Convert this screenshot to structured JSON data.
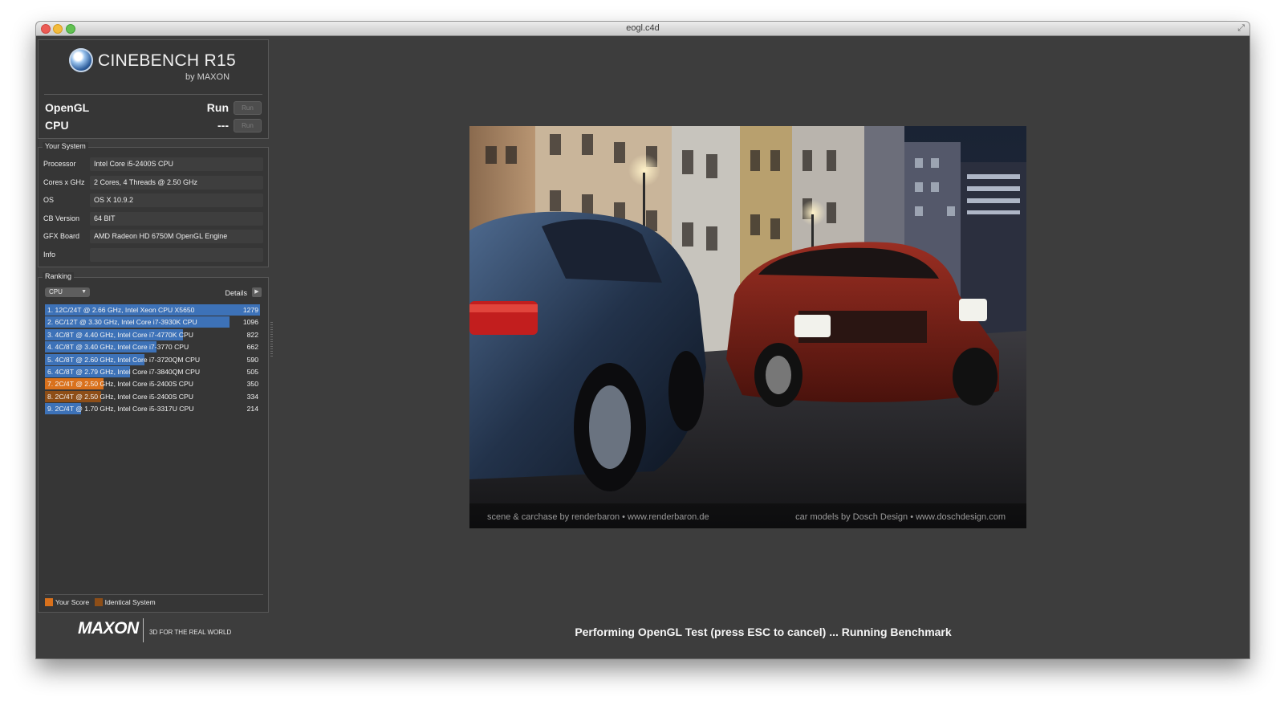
{
  "window": {
    "title": "eogl.c4d"
  },
  "app": {
    "name": "CINEBENCH R15",
    "byline": "by MAXON"
  },
  "tests": [
    {
      "name": "OpenGL",
      "score": "Run",
      "button": "Run"
    },
    {
      "name": "CPU",
      "score": "---",
      "button": "Run"
    }
  ],
  "your_system": {
    "title": "Your System",
    "rows": [
      {
        "label": "Processor",
        "value": "Intel Core i5-2400S CPU"
      },
      {
        "label": "Cores x GHz",
        "value": "2 Cores, 4 Threads @ 2.50 GHz"
      },
      {
        "label": "OS",
        "value": "OS X 10.9.2"
      },
      {
        "label": "CB Version",
        "value": "64 BIT"
      },
      {
        "label": "GFX Board",
        "value": "AMD Radeon HD 6750M OpenGL Engine"
      },
      {
        "label": "Info",
        "value": ""
      }
    ]
  },
  "ranking": {
    "title": "Ranking",
    "selected": "CPU",
    "details_label": "Details",
    "max": 1279,
    "items": [
      {
        "label": "1. 12C/24T @ 2.66 GHz, Intel Xeon CPU X5650",
        "score": 1279,
        "type": "other"
      },
      {
        "label": "2. 6C/12T @ 3.30 GHz,  Intel Core i7-3930K CPU",
        "score": 1096,
        "type": "other"
      },
      {
        "label": "3. 4C/8T @ 4.40 GHz, Intel Core i7-4770K CPU",
        "score": 822,
        "type": "other"
      },
      {
        "label": "4. 4C/8T @ 3.40 GHz,  Intel Core i7-3770 CPU",
        "score": 662,
        "type": "other"
      },
      {
        "label": "5. 4C/8T @ 2.60 GHz, Intel Core i7-3720QM CPU",
        "score": 590,
        "type": "other"
      },
      {
        "label": "6. 4C/8T @ 2.79 GHz,  Intel Core i7-3840QM CPU",
        "score": 505,
        "type": "other"
      },
      {
        "label": "7. 2C/4T @ 2.50 GHz, Intel Core i5-2400S CPU",
        "score": 350,
        "type": "mine"
      },
      {
        "label": "8. 2C/4T @ 2.50 GHz, Intel Core i5-2400S CPU",
        "score": 334,
        "type": "ident"
      },
      {
        "label": "9. 2C/4T @ 1.70 GHz,  Intel Core i5-3317U CPU",
        "score": 214,
        "type": "other"
      }
    ],
    "legend": {
      "your_score": "Your Score",
      "identical": "Identical System"
    }
  },
  "footer": {
    "logo": "MAXON",
    "tagline": "3D FOR THE REAL WORLD"
  },
  "render": {
    "credit_left": "scene & carchase by renderbaron • www.renderbaron.de",
    "credit_right": "car models by Dosch Design • www.doschdesign.com"
  },
  "status": "Performing OpenGL Test (press ESC to cancel) ... Running Benchmark",
  "colors": {
    "bar": "#3d72b8",
    "your_score": "#d9711c",
    "identical": "#8e4e17"
  }
}
